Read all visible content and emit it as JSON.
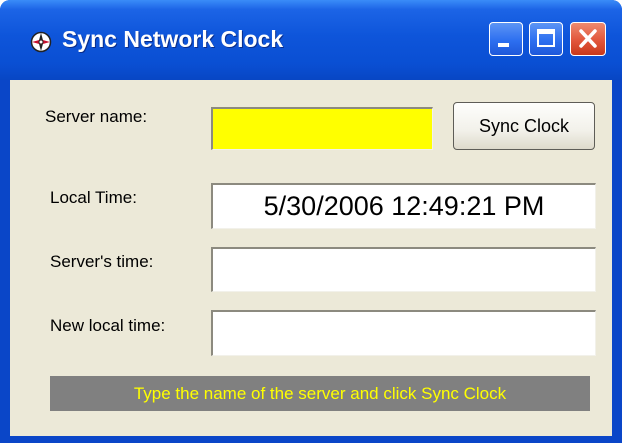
{
  "window": {
    "title": "Sync Network Clock",
    "app_icon": "compass-icon",
    "controls": {
      "minimize": "minimize-icon",
      "maximize": "maximize-icon",
      "close": "close-icon"
    }
  },
  "form": {
    "server_name": {
      "label": "Server name:",
      "value": "",
      "highlight_color": "#FFFF00"
    },
    "sync_button_label": "Sync Clock",
    "local_time": {
      "label": "Local Time:",
      "value": "5/30/2006 12:49:21 PM"
    },
    "server_time": {
      "label": "Server's time:",
      "value": ""
    },
    "new_local_time": {
      "label": "New local time:",
      "value": ""
    }
  },
  "status": {
    "message": "Type the name of the server and click Sync Clock",
    "background": "#808080",
    "text_color": "#FFFF00"
  }
}
